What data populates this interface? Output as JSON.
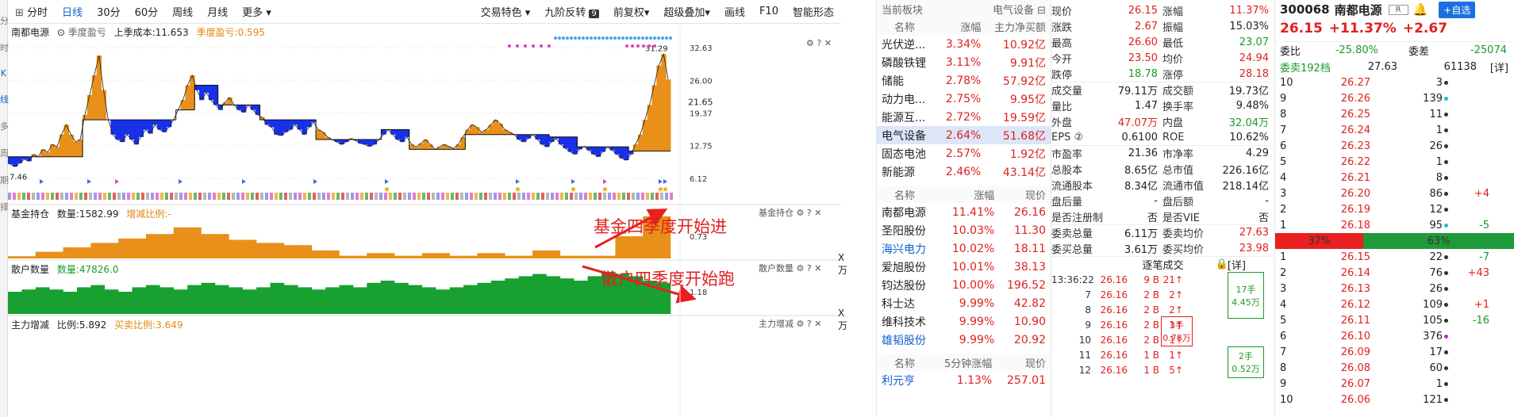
{
  "left_tab": [
    "分",
    "时",
    "K",
    "线",
    "多",
    "周",
    "期",
    "择"
  ],
  "toolbar": {
    "left": [
      "分时",
      "日线",
      "30分",
      "60分",
      "周线",
      "月线",
      "更多"
    ],
    "active": "日线",
    "right": [
      "交易特色",
      "九阶反转",
      "前复权",
      "超级叠加",
      "画线",
      "F10",
      "智能形态"
    ]
  },
  "main_panel": {
    "stock_name": "南都电源",
    "indicator": "季度盈亏",
    "cost_label": "上季成本:11.653",
    "profit_label": "季度盈亏:0.595",
    "price_ticks": [
      "32.63",
      "26.00",
      "19.37",
      "12.75",
      "6.12"
    ],
    "current_price_tag": "21.65",
    "high_label": "31.29",
    "low_label": "7.46"
  },
  "fund_panel": {
    "title": "基金持仓",
    "quantity": "数量:1582.99",
    "ratio": "增减比例:-",
    "tick": "0.73",
    "unit": "X万",
    "annotation": "基金四季度开始进"
  },
  "retail_panel": {
    "title": "散户数量",
    "quantity": "数量:47826.0",
    "tick": "1.18",
    "unit": "X万",
    "annotation": "散户四季度开始跑"
  },
  "main_force_panel": {
    "title": "主力增减",
    "ratio": "比例:5.892",
    "buysell": "买卖比例:3.649"
  },
  "sector_header": {
    "col1": "当前板块",
    "col2": "电气设备"
  },
  "sectors_columns": [
    "名称",
    "涨幅",
    "主力净买额"
  ],
  "sectors": [
    {
      "name": "光伏逆...",
      "chg": "3.34%",
      "flow": "10.92亿"
    },
    {
      "name": "磷酸铁锂",
      "chg": "3.11%",
      "flow": "9.91亿"
    },
    {
      "name": "储能",
      "chg": "2.78%",
      "flow": "57.92亿"
    },
    {
      "name": "动力电...",
      "chg": "2.75%",
      "flow": "9.95亿"
    },
    {
      "name": "能源互...",
      "chg": "2.72%",
      "flow": "19.59亿"
    },
    {
      "name": "电气设备",
      "chg": "2.64%",
      "flow": "51.68亿"
    },
    {
      "name": "固态电池",
      "chg": "2.57%",
      "flow": "1.92亿"
    },
    {
      "name": "新能源",
      "chg": "2.46%",
      "flow": "43.14亿"
    }
  ],
  "stocks_columns": [
    "名称",
    "涨幅",
    "现价"
  ],
  "stocks": [
    {
      "name": "南都电源",
      "chg": "11.41%",
      "price": "26.16"
    },
    {
      "name": "圣阳股份",
      "chg": "10.03%",
      "price": "11.30"
    },
    {
      "name": "海兴电力",
      "chg": "10.02%",
      "price": "18.11"
    },
    {
      "name": "爱旭股份",
      "chg": "10.01%",
      "price": "38.13"
    },
    {
      "name": "钧达股份",
      "chg": "10.00%",
      "price": "196.52"
    },
    {
      "name": "科士达",
      "chg": "9.99%",
      "price": "42.82"
    },
    {
      "name": "维科技术",
      "chg": "9.99%",
      "price": "10.90"
    },
    {
      "name": "雄韬股份",
      "chg": "9.99%",
      "price": "20.92"
    }
  ],
  "five_min_columns": [
    "名称",
    "5分钟涨幅",
    "现价"
  ],
  "five_min": [
    {
      "name": "利元亨",
      "chg": "1.13%",
      "price": "257.01"
    }
  ],
  "quote": [
    [
      "现价",
      "26.15",
      "涨幅",
      "11.37%"
    ],
    [
      "涨跌",
      "2.67",
      "振幅",
      "15.03%"
    ],
    [
      "最高",
      "26.60",
      "最低",
      "23.07"
    ],
    [
      "今开",
      "23.50",
      "均价",
      "24.94"
    ],
    [
      "跌停",
      "18.78",
      "涨停",
      "28.18"
    ],
    [
      "成交量",
      "79.11万",
      "成交额",
      "19.73亿"
    ],
    [
      "量比",
      "1.47",
      "换手率",
      "9.48%"
    ],
    [
      "外盘",
      "47.07万",
      "内盘",
      "32.04万"
    ],
    [
      "EPS ②",
      "0.6100",
      "ROE",
      "10.62%"
    ],
    [
      "市盈率",
      "21.36",
      "市净率",
      "4.29"
    ],
    [
      "总股本",
      "8.65亿",
      "总市值",
      "226.16亿"
    ],
    [
      "流通股本",
      "8.34亿",
      "流通市值",
      "218.14亿"
    ],
    [
      "盘后量",
      "-",
      "盘后额",
      "-"
    ],
    [
      "是否注册制",
      "否",
      "是否VIE",
      "否"
    ],
    [
      "委卖总量",
      "6.11万",
      "委卖均价",
      "27.63"
    ],
    [
      "委买总量",
      "3.61万",
      "委买均价",
      "23.98"
    ]
  ],
  "tick_header": {
    "title": "逐笔成交",
    "detail": "[详]"
  },
  "ticks": [
    {
      "time": "13:36:22",
      "price": "26.16",
      "lots": "9 B",
      "vol": "21"
    },
    {
      "time": "7",
      "price": "26.16",
      "lots": "2 B",
      "vol": "2"
    },
    {
      "time": "8",
      "price": "26.16",
      "lots": "2 B",
      "vol": "2"
    },
    {
      "time": "9",
      "price": "26.16",
      "lots": "2 B",
      "vol": "1"
    },
    {
      "time": "10",
      "price": "26.16",
      "lots": "2 B",
      "vol": "1"
    },
    {
      "time": "11",
      "price": "26.16",
      "lots": "1 B",
      "vol": "1"
    },
    {
      "time": "12",
      "price": "26.16",
      "lots": "1 B",
      "vol": "5"
    }
  ],
  "tick_boxes": [
    {
      "a": "17手",
      "b": "4.45万"
    },
    {
      "a": "3手",
      "b": "0.78万"
    },
    {
      "a": "2手",
      "b": "0.52万"
    }
  ],
  "book_header": {
    "code": "300068",
    "name": "南都电源",
    "badge": "R",
    "add": "+自选",
    "price": "26.15",
    "pct": "+11.37%",
    "chg": "+2.67",
    "wb_label": "委比",
    "wb": "-25.80%",
    "wc_label": "委差",
    "wc": "-25074",
    "sell_total": "委卖192档",
    "sell_price": "27.63",
    "sell_vol": "61138",
    "detail": "[详]"
  },
  "asks": [
    {
      "lv": "10",
      "price": "26.27",
      "vol": "3",
      "dot": "#333",
      "ch": ""
    },
    {
      "lv": "9",
      "price": "26.26",
      "vol": "139",
      "dot": "#22bbd0",
      "ch": ""
    },
    {
      "lv": "8",
      "price": "26.25",
      "vol": "11",
      "dot": "#333",
      "ch": ""
    },
    {
      "lv": "7",
      "price": "26.24",
      "vol": "1",
      "dot": "#333",
      "ch": ""
    },
    {
      "lv": "6",
      "price": "26.23",
      "vol": "26",
      "dot": "#333",
      "ch": ""
    },
    {
      "lv": "5",
      "price": "26.22",
      "vol": "1",
      "dot": "#333",
      "ch": ""
    },
    {
      "lv": "4",
      "price": "26.21",
      "vol": "8",
      "dot": "#333",
      "ch": ""
    },
    {
      "lv": "3",
      "price": "26.20",
      "vol": "86",
      "dot": "#333",
      "ch": "+4"
    },
    {
      "lv": "2",
      "price": "26.19",
      "vol": "12",
      "dot": "#333",
      "ch": ""
    },
    {
      "lv": "1",
      "price": "26.18",
      "vol": "95",
      "dot": "#22bbd0",
      "ch": "-5"
    }
  ],
  "ratio_bar": {
    "sell": "37%",
    "buy": "63%",
    "sell_frac": 0.37
  },
  "bids": [
    {
      "lv": "1",
      "price": "26.15",
      "vol": "22",
      "dot": "#333",
      "ch": "-7"
    },
    {
      "lv": "2",
      "price": "26.14",
      "vol": "76",
      "dot": "#333",
      "ch": "+43"
    },
    {
      "lv": "3",
      "price": "26.13",
      "vol": "26",
      "dot": "#333",
      "ch": ""
    },
    {
      "lv": "4",
      "price": "26.12",
      "vol": "109",
      "dot": "#333",
      "ch": "+1"
    },
    {
      "lv": "5",
      "price": "26.11",
      "vol": "105",
      "dot": "#333",
      "ch": "-16"
    },
    {
      "lv": "6",
      "price": "26.10",
      "vol": "376",
      "dot": "#d020d0",
      "ch": ""
    },
    {
      "lv": "7",
      "price": "26.09",
      "vol": "17",
      "dot": "#333",
      "ch": ""
    },
    {
      "lv": "8",
      "price": "26.08",
      "vol": "60",
      "dot": "#333",
      "ch": ""
    },
    {
      "lv": "9",
      "price": "26.07",
      "vol": "1",
      "dot": "#333",
      "ch": ""
    },
    {
      "lv": "10",
      "price": "26.06",
      "vol": "121",
      "dot": "#333",
      "ch": ""
    }
  ],
  "chart_data": {
    "type": "area",
    "title": "季度盈亏",
    "ylim": [
      6.12,
      32.63
    ],
    "price_series": [
      9,
      8.5,
      9.2,
      10,
      9.6,
      11,
      10.5,
      12,
      11.4,
      13,
      12.5,
      15,
      17,
      15,
      13.5,
      14,
      19,
      23,
      27,
      31,
      24,
      18,
      15,
      14,
      13.5,
      15,
      14,
      13,
      14.5,
      16,
      15.2,
      17,
      16,
      15.5,
      16.5,
      18,
      20,
      22,
      25,
      27,
      24,
      22,
      23.5,
      22,
      21,
      20,
      21.5,
      22.5,
      21,
      20,
      19.5,
      21,
      20,
      19,
      18.5,
      17,
      16.5,
      15,
      14.8,
      15.5,
      16,
      17,
      16,
      15,
      16.5,
      17.5,
      16,
      15.5,
      14.5,
      14,
      13.5,
      13,
      13.5,
      14.2,
      13.8,
      13.2,
      13,
      12.6,
      13,
      14,
      15,
      16,
      15,
      14,
      13.5,
      14.5,
      13,
      12.5,
      13.2,
      14,
      13,
      12,
      12.5,
      13,
      12.6,
      12.2,
      13,
      14.5,
      16,
      17,
      16.5,
      15.5,
      16,
      17,
      18,
      17.2,
      16,
      15.5,
      15,
      14,
      13.5,
      14.2,
      15,
      14,
      13,
      12.5,
      13.5,
      14.2,
      13,
      12.2,
      11.5,
      11,
      12,
      12.6,
      11.8,
      11,
      10.5,
      11.5,
      12.5,
      11.8,
      11,
      10.2,
      9.8,
      11,
      13,
      15,
      18,
      21,
      25,
      29,
      31.29,
      26.15
    ],
    "cost_series": [
      10.5,
      10.5,
      10.5,
      10.5,
      10.5,
      10.5,
      10.5,
      10.5,
      10.5,
      10.5,
      10.5,
      10.5,
      10.5,
      10.5,
      10.5,
      10.5,
      18,
      18,
      18,
      18,
      18,
      18,
      18,
      18,
      18,
      18,
      18,
      18,
      18,
      18,
      18,
      18,
      18,
      18,
      18,
      18,
      20,
      20,
      20,
      20,
      25,
      25,
      25,
      25,
      25,
      21,
      21,
      21,
      21,
      21,
      21,
      21,
      21,
      21,
      18,
      18,
      18,
      18,
      18,
      18,
      18,
      18,
      18,
      18,
      18,
      18,
      14,
      14,
      14,
      14,
      14,
      14,
      14,
      14,
      14,
      14,
      14,
      14,
      14,
      14,
      16,
      16,
      16,
      16,
      16,
      16,
      12,
      12,
      12,
      12,
      12,
      12,
      12,
      12,
      12,
      12,
      12,
      12,
      15,
      15,
      15,
      15,
      15,
      15,
      15,
      15,
      15,
      15,
      15,
      15,
      15,
      15,
      15,
      15,
      15,
      15,
      14.5,
      14.5,
      14.5,
      14.5,
      14.5,
      14.5,
      12.5,
      12.5,
      12.5,
      12.5,
      12.5,
      12.5,
      12.5,
      12.5,
      12.5,
      12.5,
      12.5,
      11.65,
      11.65,
      11.65,
      11.65,
      11.65,
      11.65,
      11.65,
      11.65,
      11.65
    ],
    "fund_holdings": [
      0.05,
      0.05,
      0.15,
      0.15,
      0.25,
      0.25,
      0.35,
      0.35,
      0.45,
      0.45,
      0.55,
      0.55,
      0.7,
      0.7,
      0.55,
      0.55,
      0.42,
      0.42,
      0.35,
      0.35,
      0.3,
      0.3,
      0.18,
      0.18,
      0.06,
      0.06,
      0.12,
      0.12,
      0.06,
      0.06,
      0.12,
      0.12,
      0.06,
      0.06,
      0.12,
      0.12,
      0.06,
      0.06,
      0.18,
      0.18,
      0.06,
      0.06,
      0.06,
      0.06,
      0.5,
      0.5,
      0.95,
      0.95
    ],
    "retail_counts": [
      0.5,
      0.55,
      0.6,
      0.55,
      0.5,
      0.6,
      0.65,
      0.55,
      0.5,
      0.6,
      0.65,
      0.6,
      0.55,
      0.65,
      0.7,
      0.65,
      0.6,
      0.55,
      0.6,
      0.7,
      0.65,
      0.6,
      0.55,
      0.6,
      0.65,
      0.6,
      0.7,
      0.75,
      0.7,
      0.65,
      0.6,
      0.55,
      0.6,
      0.65,
      0.7,
      0.75,
      0.8,
      0.85,
      0.9,
      0.85,
      0.8,
      0.75,
      0.85,
      0.95,
      0.9,
      0.85,
      0.75,
      0.7
    ]
  }
}
